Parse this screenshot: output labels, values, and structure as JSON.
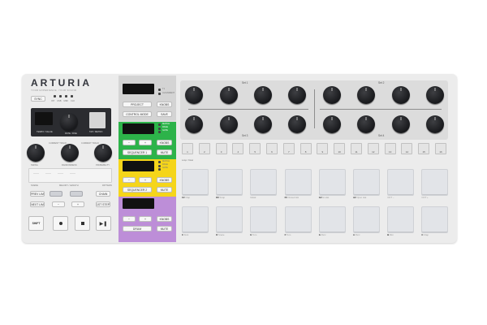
{
  "brand": {
    "name": "ARTURIA",
    "tagline": "YOUR EXPERIENCE, YOUR SOUND"
  },
  "left": {
    "sync_label": "SYNC",
    "sync_leds": [
      "INT",
      "USB",
      "MIDI",
      "CLK"
    ],
    "encoder_labels": [
      "TEMPO / VALUE",
      "RATE / FINE",
      "TAP / METRO"
    ],
    "knob_labels": [
      "SWING",
      "RANDOMNESS",
      "PROBABILITY"
    ],
    "knob_sub_labels": [
      "CURRENT TRACK",
      "CURRENT TRACK"
    ],
    "strip_labels": [
      "SCENE",
      "MELODY / LENGTH",
      "PATTERN"
    ],
    "buttons": {
      "prev_left": "PREV LIM",
      "chain": "CHAIN",
      "next_lim": "NEXT LIM",
      "let_step": "1ST STEP",
      "oct_down": "−",
      "oct_up": "+",
      "shift": "SHIFT"
    },
    "transport": [
      "record",
      "stop",
      "play-pause"
    ]
  },
  "middle": {
    "project": "PROJECT",
    "knobs": "KNOBS",
    "control_mode": "CONTROL MODE",
    "save": "SAVE",
    "sequencer1": "SEQUENCER 1",
    "sequencer2": "SEQUENCER 2",
    "drum": "DRUM",
    "knobs_btn": "KNOBS",
    "mute": "MUTE",
    "leds": [
      "MATCH",
      "PAGE",
      "GATE"
    ],
    "arrows": [
      "−",
      "+"
    ],
    "led_labels_top": [
      "T1",
      "ALIGNMENT"
    ]
  },
  "knob_section": {
    "sets": [
      "Set 1",
      "Set 2",
      "Set 3",
      "Set 4"
    ],
    "knob_count": 16
  },
  "steps": [
    "1",
    "2",
    "3",
    "4",
    "5",
    "6",
    "7",
    "8",
    "9",
    "10",
    "11",
    "12",
    "13",
    "14",
    "15",
    "16"
  ],
  "step_label": "Loop / Clear",
  "pads_top": [
    {
      "note": "C#",
      "label": "Clap"
    },
    {
      "note": "D#",
      "label": "Snap"
    },
    {
      "note": "",
      "label": "Metal"
    },
    {
      "note": "F#",
      "label": "Closed HH"
    },
    {
      "note": "G#",
      "label": "Hi-Hat"
    },
    {
      "note": "A#",
      "label": "Open Hat"
    },
    {
      "note": "",
      "label": "OCT −"
    },
    {
      "note": "",
      "label": "OCT +"
    }
  ],
  "pads_bottom": [
    {
      "note": "C",
      "label": "Kick"
    },
    {
      "note": "D",
      "label": "Snare"
    },
    {
      "note": "E",
      "label": "Tom"
    },
    {
      "note": "F",
      "label": "Tom"
    },
    {
      "note": "G",
      "label": "Perc"
    },
    {
      "note": "A",
      "label": "Perc"
    },
    {
      "note": "B",
      "label": "Rim"
    },
    {
      "note": "C",
      "label": "Clap"
    }
  ],
  "colors": {
    "green": "#2db34a",
    "yellow": "#f5d51a",
    "purple": "#bd8ed8",
    "panel": "#ececec",
    "knob": "#1e1f22"
  }
}
